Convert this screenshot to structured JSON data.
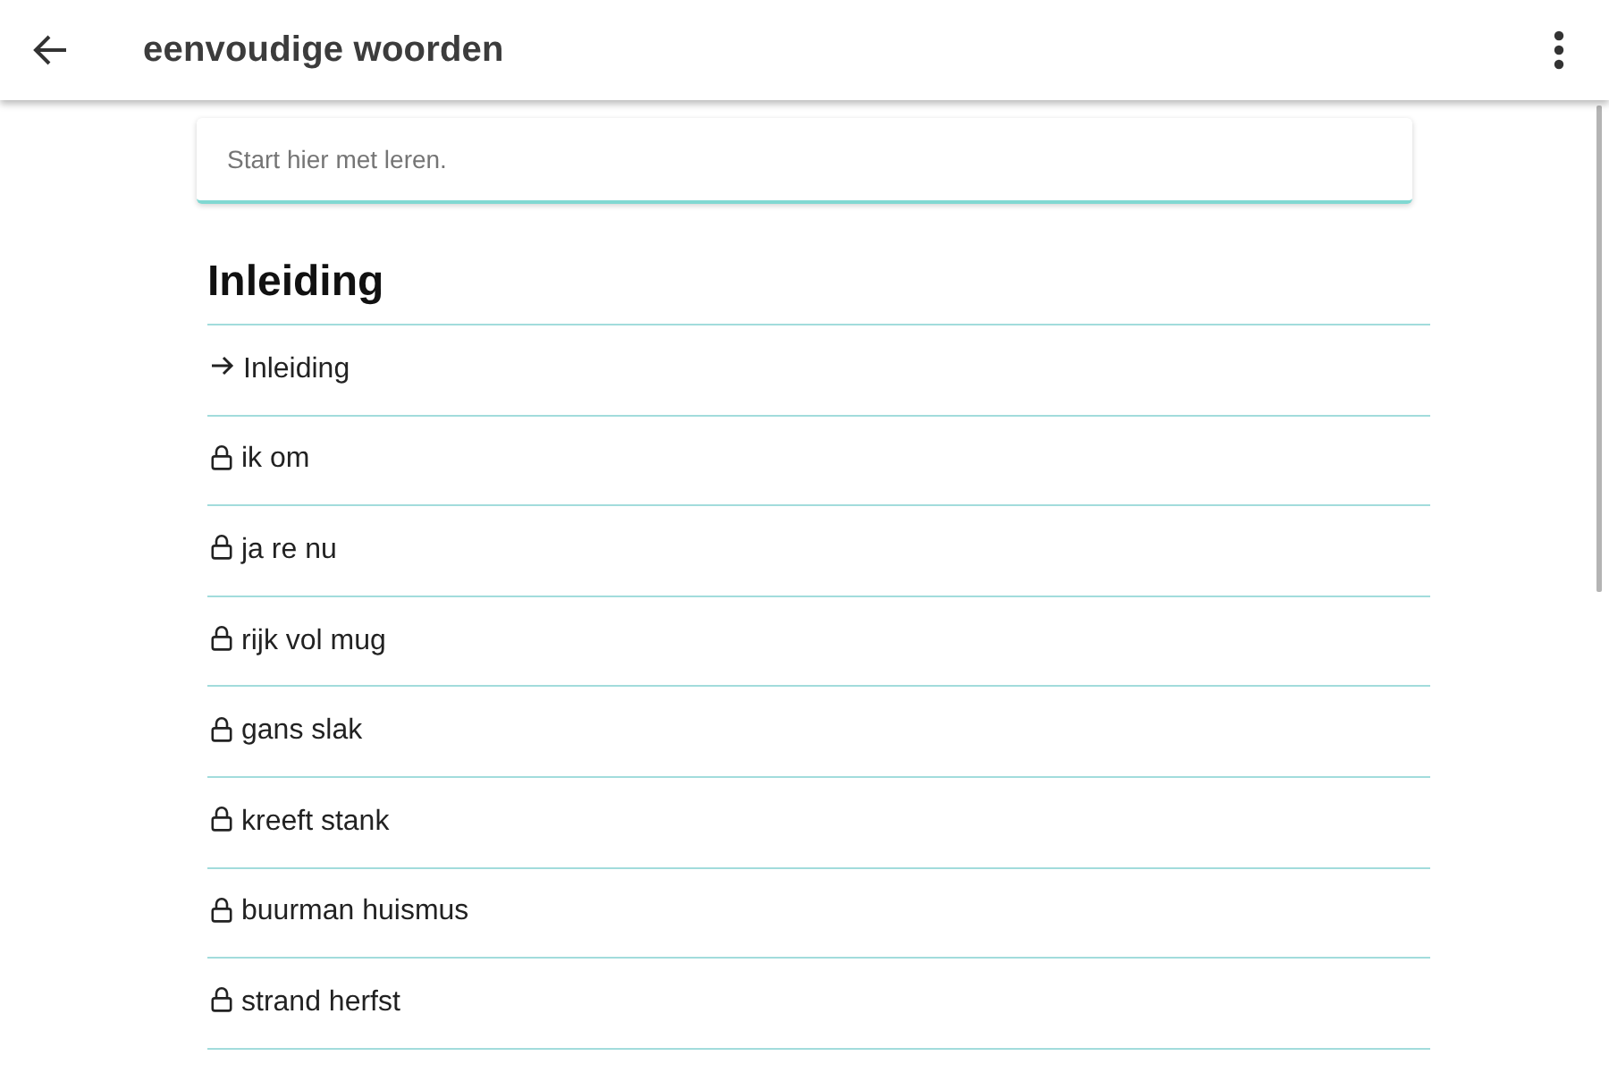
{
  "app_bar": {
    "title": "eenvoudige woorden"
  },
  "intro_card": {
    "text": "Start hier met leren."
  },
  "section": {
    "title": "Inleiding",
    "lessons": [
      {
        "title": "Inleiding",
        "locked": false
      },
      {
        "title": "ik om",
        "locked": true
      },
      {
        "title": "ja re nu",
        "locked": true
      },
      {
        "title": "rijk vol mug",
        "locked": true
      },
      {
        "title": "gans slak",
        "locked": true
      },
      {
        "title": "kreeft stank",
        "locked": true
      },
      {
        "title": "buurman huismus",
        "locked": true
      },
      {
        "title": "strand herfst",
        "locked": true
      }
    ]
  }
}
